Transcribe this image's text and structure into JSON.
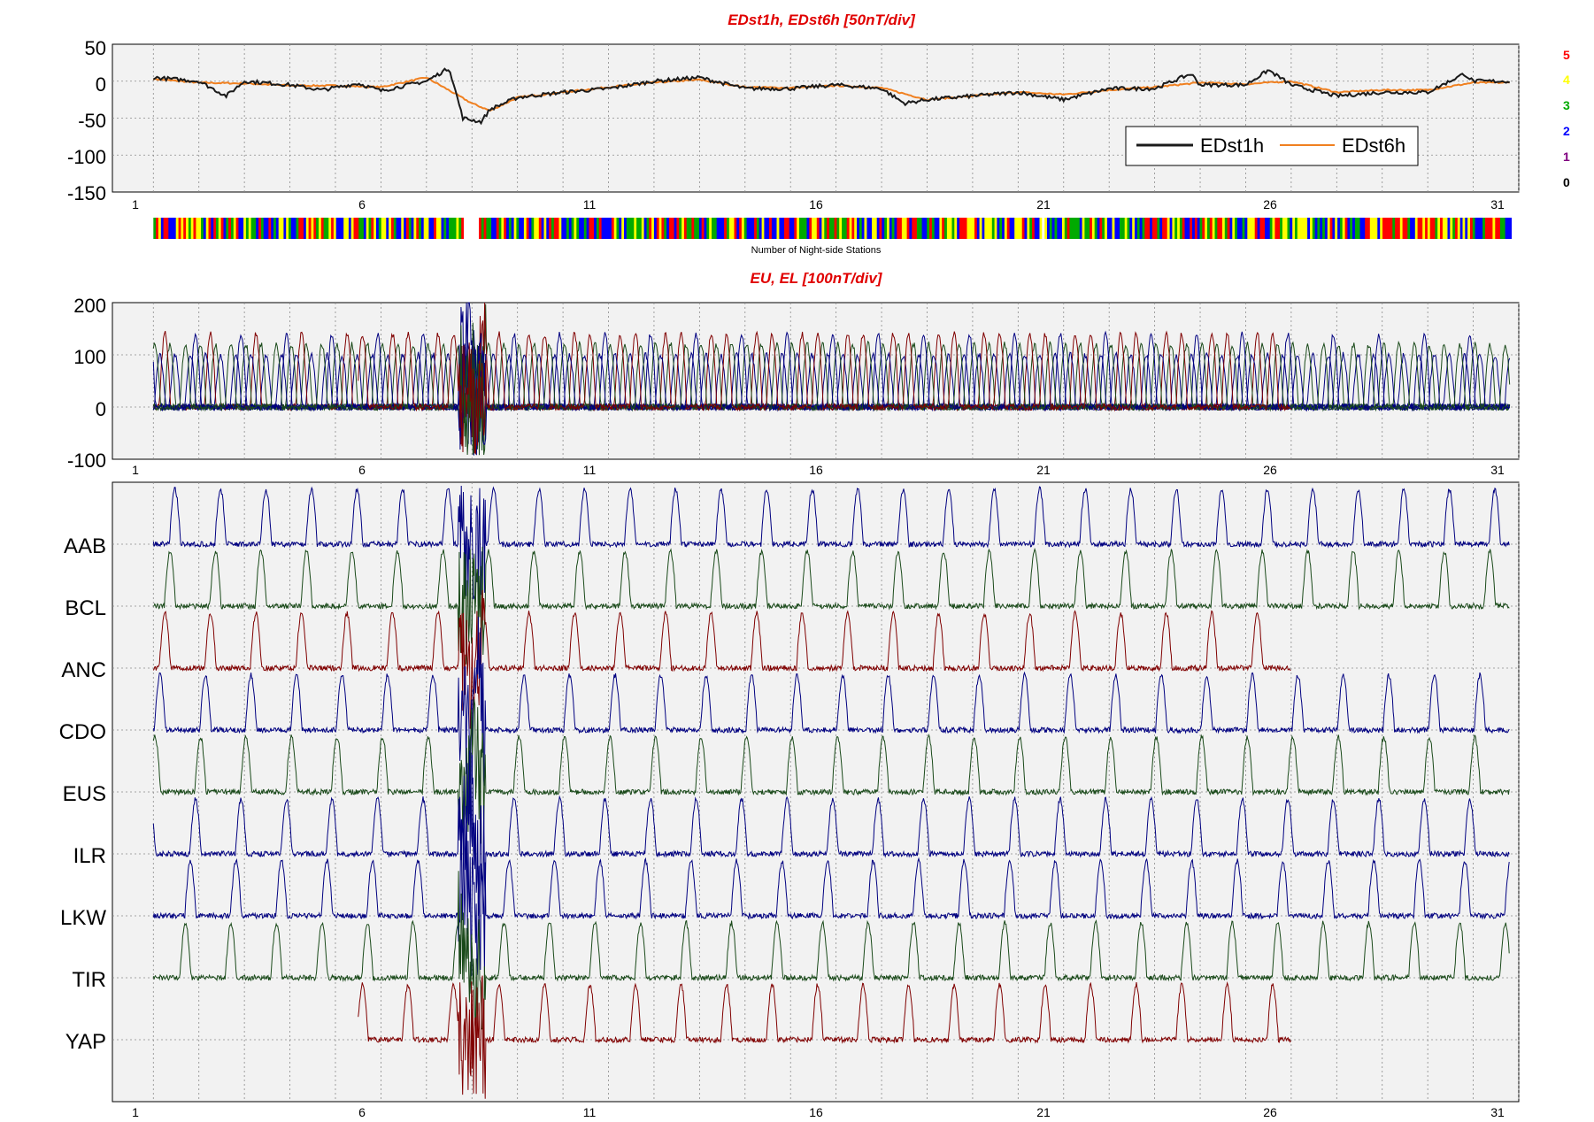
{
  "chart_data": [
    {
      "type": "line",
      "title": "EDst1h, EDst6h [50nT/div]",
      "x_range": [
        0.1,
        31.0
      ],
      "x_ticks": [
        "1",
        "6",
        "11",
        "16",
        "21",
        "26",
        "31"
      ],
      "ylim": [
        -150,
        50
      ],
      "y_ticks": [
        "50",
        "0",
        "-50",
        "-100",
        "-150"
      ],
      "grid": true,
      "legend": {
        "placement": "lower-right",
        "entries": [
          "EDst1h",
          "EDst6h"
        ]
      },
      "series": [
        {
          "name": "EDst1h",
          "color": "#1a1a1a",
          "x": [
            1,
            2,
            2.6,
            3,
            4,
            4.7,
            5.5,
            6,
            6.6,
            7,
            7.5,
            7.8,
            8.2,
            8.4,
            9,
            10,
            11,
            12,
            13,
            14,
            15,
            16,
            17,
            17.5,
            18,
            19,
            20,
            21,
            22,
            23,
            23.8,
            24,
            25,
            25.5,
            26,
            27,
            28,
            29,
            29.8,
            30,
            31
          ],
          "values": [
            5,
            0,
            -20,
            0,
            -5,
            -12,
            -3,
            -13,
            -5,
            0,
            18,
            -50,
            -55,
            -38,
            -22,
            -15,
            -10,
            0,
            5,
            -10,
            -10,
            -5,
            -10,
            -30,
            -25,
            -20,
            -15,
            -25,
            -10,
            -10,
            10,
            -5,
            -5,
            15,
            -5,
            -20,
            -15,
            -15,
            10,
            0,
            0
          ]
        },
        {
          "name": "EDst6h",
          "color": "#f08020",
          "x": [
            1,
            2,
            3,
            4,
            5,
            6,
            7,
            8,
            8.4,
            9,
            10,
            11,
            12,
            13,
            14,
            15,
            16,
            17,
            18,
            19,
            20,
            21,
            22,
            23,
            24,
            25,
            26,
            27,
            28,
            29,
            30,
            31
          ],
          "values": [
            3,
            -2,
            -3,
            -6,
            -6,
            -8,
            5,
            -30,
            -40,
            -22,
            -15,
            -8,
            -2,
            2,
            -8,
            -9,
            -6,
            -9,
            -25,
            -20,
            -15,
            -18,
            -12,
            -8,
            -2,
            -4,
            0,
            -15,
            -12,
            -12,
            -2,
            -2
          ]
        }
      ]
    },
    {
      "type": "heatmap",
      "xlabel": "Number of Night-side Stations",
      "colorbar": {
        "levels": [
          "5",
          "4",
          "3",
          "2",
          "1",
          "0"
        ],
        "colors": [
          "#ff0000",
          "#ffff00",
          "#00aa00",
          "#0000ff",
          "#800080",
          "#000000"
        ]
      }
    },
    {
      "type": "line",
      "title": "EU, EL   [100nT/div]",
      "x_range": [
        0.1,
        31.0
      ],
      "x_ticks": [
        "1",
        "6",
        "11",
        "16",
        "21",
        "26",
        "31"
      ],
      "ylim": [
        -100,
        200
      ],
      "y_ticks": [
        "200",
        "100",
        "0",
        "-100"
      ],
      "grid": true,
      "series_colors": [
        "#000080",
        "#1a4a1a",
        "#800000"
      ],
      "daily_peak_nT": [
        100,
        140
      ],
      "storm_spike": {
        "day": 8,
        "min_nT": -90,
        "max_nT": 200
      }
    },
    {
      "type": "line",
      "x_range": [
        0.1,
        31.0
      ],
      "x_ticks": [
        "1",
        "6",
        "11",
        "16",
        "21",
        "26",
        "31"
      ],
      "grid": true,
      "stations": [
        {
          "name": "AAB",
          "color": "#000080",
          "start_day": 1,
          "end_day": 31
        },
        {
          "name": "BCL",
          "color": "#1a4a1a",
          "start_day": 1,
          "end_day": 31
        },
        {
          "name": "ANC",
          "color": "#800000",
          "start_day": 1,
          "end_day": 26
        },
        {
          "name": "CDO",
          "color": "#000080",
          "start_day": 1,
          "end_day": 31
        },
        {
          "name": "EUS",
          "color": "#1a4a1a",
          "start_day": 1,
          "end_day": 31
        },
        {
          "name": "ILR",
          "color": "#000080",
          "start_day": 1,
          "end_day": 31
        },
        {
          "name": "LKW",
          "color": "#000080",
          "start_day": 1,
          "end_day": 31
        },
        {
          "name": "TIR",
          "color": "#1a4a1a",
          "start_day": 1,
          "end_day": 31
        },
        {
          "name": "YAP",
          "color": "#800000",
          "start_day": 5.5,
          "end_day": 26
        }
      ]
    }
  ]
}
